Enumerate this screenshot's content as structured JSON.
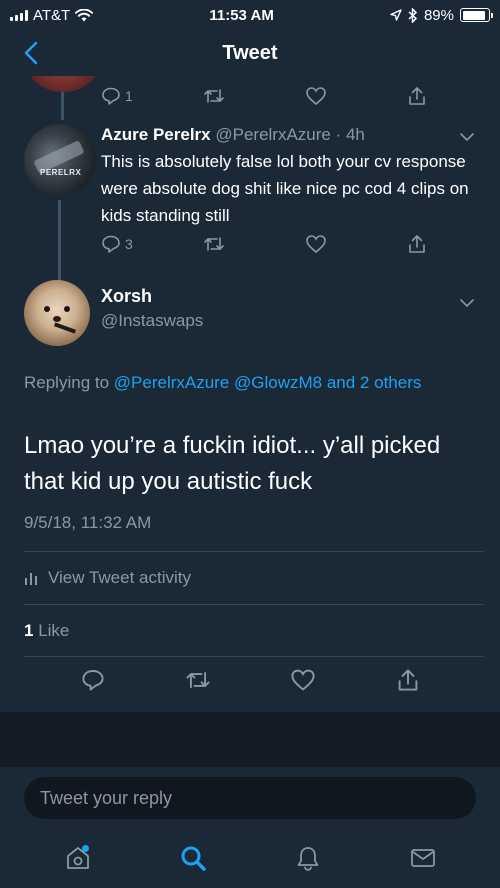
{
  "status_bar": {
    "carrier": "AT&T",
    "time": "11:53 AM",
    "battery_percent": "89%",
    "battery_level": 0.89
  },
  "nav": {
    "title": "Tweet"
  },
  "previous_tweet_actions": {
    "reply_count": "1"
  },
  "reply_tweet": {
    "name": "Azure Perelrx",
    "handle_time": "@PerelrxAzure · 4h",
    "avatar_text": "PERELRX",
    "text": "This is absolutely false lol both your cv response were absolute dog shit like nice pc cod 4 clips on kids standing still",
    "reply_count": "3"
  },
  "main_tweet": {
    "name": "Xorsh",
    "handle": "@Instaswaps",
    "replying_prefix": "Replying to ",
    "replying_links": "@PerelrxAzure @GlowzM8 and 2 others",
    "text": "Lmao you’re a fuckin idiot... y’all picked that kid up you autistic fuck",
    "timestamp": "9/5/18, 11:32 AM",
    "activity_label": "View Tweet activity",
    "like_count": "1",
    "like_label": " Like"
  },
  "reply_box": {
    "placeholder": "Tweet your reply"
  },
  "colors": {
    "background": "#1b2836",
    "accent": "#1da1f2",
    "secondary_text": "#8899a6"
  }
}
